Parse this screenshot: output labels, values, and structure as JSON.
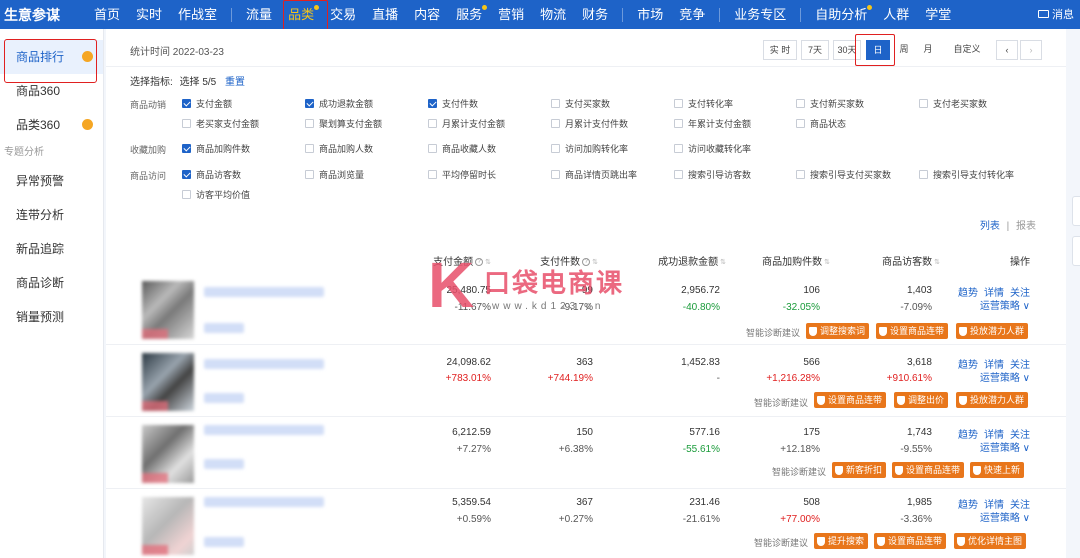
{
  "topnav": {
    "brand": "生意参谋",
    "group1": [
      "首页",
      "实时",
      "作战室"
    ],
    "group2": [
      "流量",
      "品类",
      "交易",
      "直播",
      "内容",
      "服务",
      "营销",
      "物流",
      "财务"
    ],
    "group3": [
      "市场",
      "竞争"
    ],
    "group4": [
      "业务专区"
    ],
    "group5": [
      "自助分析",
      "人群",
      "学堂"
    ],
    "message": "消息"
  },
  "sidebar": {
    "items": [
      "商品排行",
      "商品360",
      "品类360"
    ],
    "group_label": "专题分析",
    "topic_items": [
      "异常预警",
      "连带分析",
      "新品追踪",
      "商品诊断",
      "销量预测"
    ]
  },
  "statbar": {
    "time_label": "统计时间 2022-03-23",
    "buttons": [
      "实 时",
      "7天",
      "30天",
      "日",
      "周",
      "月",
      "自定义"
    ],
    "active": "日",
    "prev": "‹",
    "next": "›"
  },
  "metrics": {
    "title": "选择指标:",
    "count": "选择 5/5",
    "reset": "重置",
    "groups": [
      "商品动销",
      "收藏加购",
      "商品访问"
    ],
    "items": {
      "a1": "支付金额",
      "a2": "成功退款金额",
      "a3": "支付件数",
      "a4": "支付买家数",
      "a5": "支付转化率",
      "a6": "支付新买家数",
      "a7": "支付老买家数",
      "a8": "老买家支付金额",
      "a9": "聚划算支付金额",
      "a10": "月累计支付金额",
      "a11": "月累计支付件数",
      "a12": "年累计支付金额",
      "a13": "商品状态",
      "b1": "商品加购件数",
      "b2": "商品加购人数",
      "b3": "商品收藏人数",
      "b4": "访问加购转化率",
      "b5": "访问收藏转化率",
      "c1": "商品访客数",
      "c2": "商品浏览量",
      "c3": "平均停留时长",
      "c4": "商品详情页跳出率",
      "c5": "搜索引导访客数",
      "c6": "搜索引导支付买家数",
      "c7": "搜索引导支付转化率",
      "c8": "访客平均价值"
    }
  },
  "view": {
    "list": "列表",
    "sep": "|",
    "report": "报表"
  },
  "table": {
    "headers": [
      "支付金额",
      "支付件数",
      "成功退款金额",
      "商品加购件数",
      "商品访客数",
      "操作"
    ],
    "diag_label": "智能诊断建议",
    "op_links": [
      "趋势",
      "详情",
      "关注"
    ],
    "op_strategy": "运营策略 ∨",
    "rows": [
      {
        "pay": "25,480.75",
        "pay_pct": "-11.67%",
        "qty": "99",
        "qty_pct": "-9.17%",
        "refund": "2,956.72",
        "refund_pct": "-40.80%",
        "cart": "106",
        "cart_pct": "-32.05%",
        "visitors": "1,403",
        "visitors_pct": "-7.09%",
        "actions": [
          "调整搜索词",
          "设置商品连带",
          "投放潜力人群"
        ]
      },
      {
        "pay": "24,098.62",
        "pay_pct": "+783.01%",
        "qty": "363",
        "qty_pct": "+744.19%",
        "refund": "1,452.83",
        "refund_pct": "-",
        "cart": "566",
        "cart_pct": "+1,216.28%",
        "visitors": "3,618",
        "visitors_pct": "+910.61%",
        "actions": [
          "设置商品连带",
          "调整出价",
          "投放潜力人群"
        ]
      },
      {
        "pay": "6,212.59",
        "pay_pct": "+7.27%",
        "qty": "150",
        "qty_pct": "+6.38%",
        "refund": "577.16",
        "refund_pct": "-55.61%",
        "cart": "175",
        "cart_pct": "+12.18%",
        "visitors": "1,743",
        "visitors_pct": "-9.55%",
        "actions": [
          "新客折扣",
          "设置商品连带",
          "快速上新"
        ]
      },
      {
        "pay": "5,359.54",
        "pay_pct": "+0.59%",
        "qty": "367",
        "qty_pct": "+0.27%",
        "refund": "231.46",
        "refund_pct": "-21.61%",
        "cart": "508",
        "cart_pct": "+77.00%",
        "visitors": "1,985",
        "visitors_pct": "-3.36%",
        "actions": [
          "提升搜索",
          "设置商品连带",
          "优化详情主图"
        ]
      }
    ]
  },
  "watermark": {
    "letter": "K",
    "text": "口袋电商课",
    "url": "www.kd123.cn"
  },
  "colors": {
    "brand_blue": "#1e63c8",
    "orange": "#e8761b",
    "red": "#e02020",
    "green": "#1a9b3a"
  }
}
